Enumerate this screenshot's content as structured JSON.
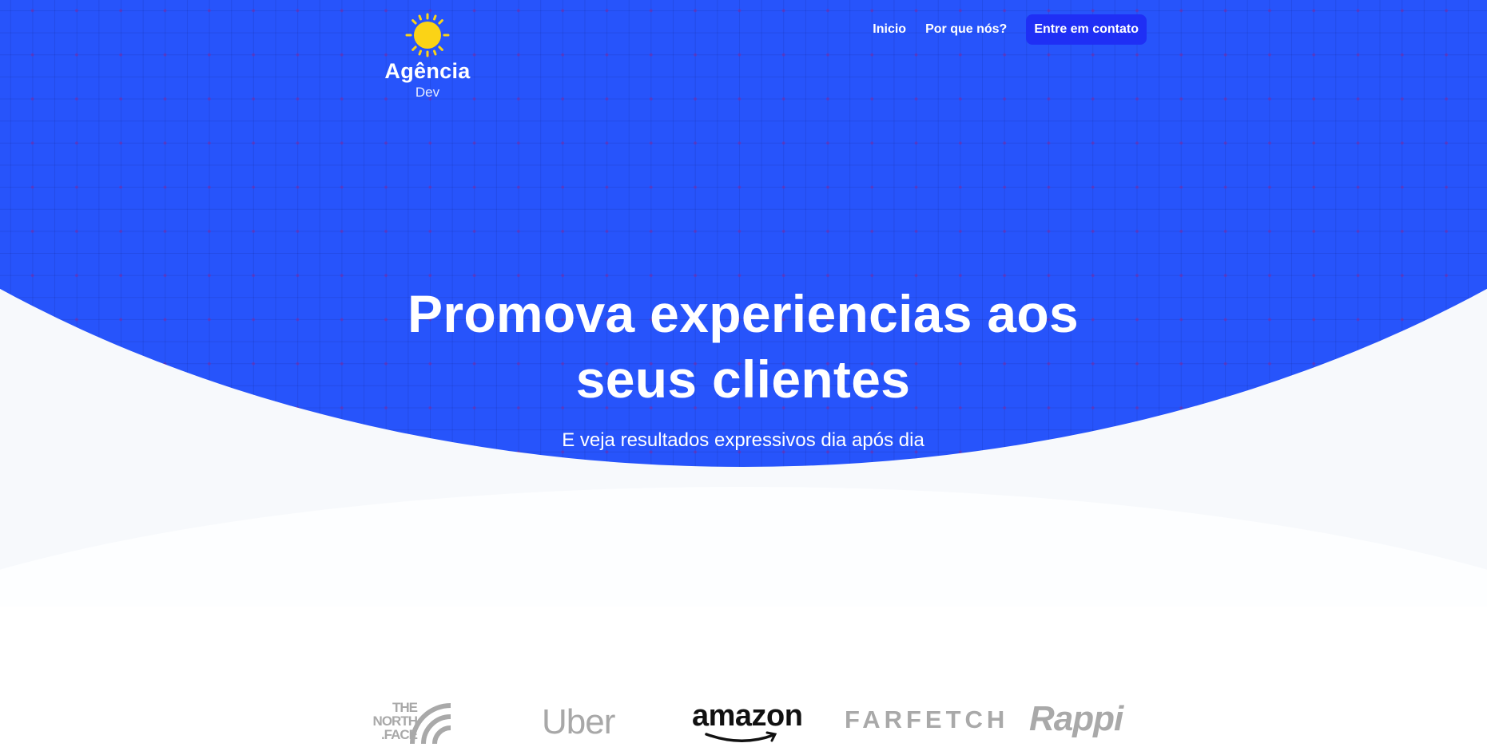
{
  "brand": {
    "name": "Agência",
    "sub": "Dev",
    "icon": "sun-icon"
  },
  "nav": {
    "items": [
      {
        "label": "Inicio"
      },
      {
        "label": "Por que nós?"
      }
    ],
    "cta_label": "Entre em contato"
  },
  "hero": {
    "title": "Promova experiencias aos seus clientes",
    "subtitle": "E veja resultados expressivos dia após dia"
  },
  "clients": [
    {
      "name": "THE NORTH FACE",
      "lines": [
        "THE",
        "NORTH",
        ".FACE"
      ]
    },
    {
      "name": "Uber"
    },
    {
      "name": "amazon"
    },
    {
      "name": "FARFETCH"
    },
    {
      "name": "Rappi"
    }
  ],
  "colors": {
    "hero_blue": "#2754fb",
    "cta_blue": "#1f2ff5",
    "sun_yellow": "#fbd316",
    "logo_gray": "#a9a9a9"
  }
}
